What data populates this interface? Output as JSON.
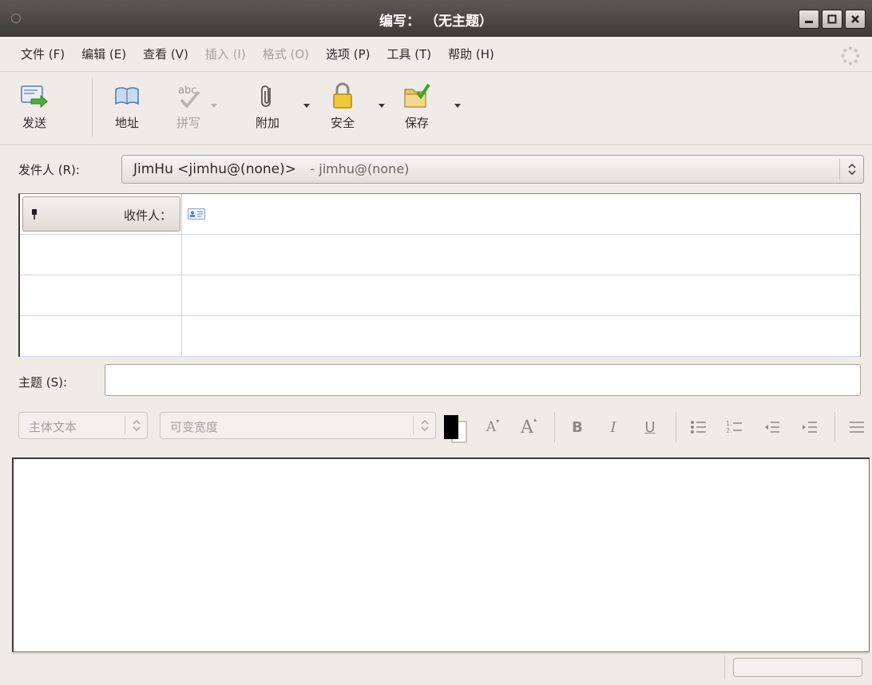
{
  "window": {
    "title": "编写： （无主题）"
  },
  "menu": {
    "items": [
      {
        "label": "文件 (F)",
        "enabled": true
      },
      {
        "label": "编辑 (E)",
        "enabled": true
      },
      {
        "label": "查看 (V)",
        "enabled": true
      },
      {
        "label": "插入 (I)",
        "enabled": false
      },
      {
        "label": "格式 (O)",
        "enabled": false
      },
      {
        "label": "选项 (P)",
        "enabled": true
      },
      {
        "label": "工具 (T)",
        "enabled": true
      },
      {
        "label": "帮助 (H)",
        "enabled": true
      }
    ]
  },
  "toolbar": {
    "send": "发送",
    "address": "地址",
    "spell": "拼写",
    "attach": "附加",
    "security": "安全",
    "save": "保存"
  },
  "from": {
    "label": "发件人 (R):",
    "value": "JimHu <jimhu@(none)>",
    "sub": "- jimhu@(none)"
  },
  "recipients": {
    "to_label": "收件人："
  },
  "subject": {
    "label": "主题 (S):",
    "value": ""
  },
  "format": {
    "paragraph_style": "主体文本",
    "font": "可变宽度",
    "bold": "B",
    "italic": "I",
    "underline": "U",
    "smaller": "A",
    "larger": "A"
  },
  "colors": {
    "text_color": "#000000",
    "background_color": "#ffffff"
  },
  "status": {
    "text": "",
    "progress": 0
  }
}
